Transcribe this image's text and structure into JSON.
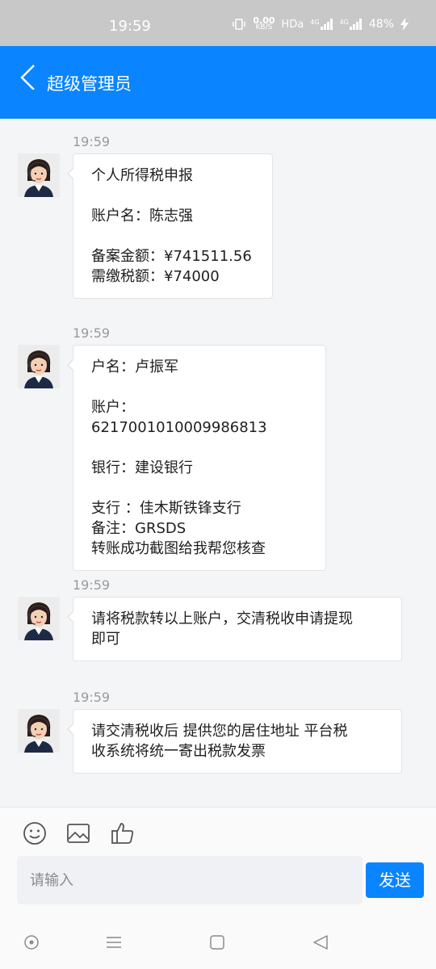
{
  "status_bar": {
    "time": "19:59",
    "net_speed": "0.00",
    "net_unit": "KB/S",
    "hd": "HDa",
    "sim1": "4G",
    "sim2": "4G",
    "battery": "48%"
  },
  "header": {
    "title": "超级管理员"
  },
  "messages": [
    {
      "time": "19:59",
      "lines": "个人所得税申报\n\n账户名：陈志强\n\n备案金额：¥741511.56\n需缴税额：¥74000"
    },
    {
      "time": "19:59",
      "lines": "户名：卢振军\n\n账户：6217001010009986813\n\n银行：建设银行\n\n支行 ：佳木斯铁锋支行\n备注：GRSDS\n转账成功截图给我帮您核查"
    },
    {
      "time": "19:59",
      "lines": "请将税款转以上账户，交清税收申请提现\n即可"
    },
    {
      "time": "19:59",
      "lines": "请交清税收后 提供您的居住地址 平台税\n收系统将统一寄出税款发票"
    }
  ],
  "composer": {
    "placeholder": "请输入",
    "send_label": "发送"
  },
  "colors": {
    "accent": "#0a84ff",
    "status_bar": "#c8c8c8"
  }
}
